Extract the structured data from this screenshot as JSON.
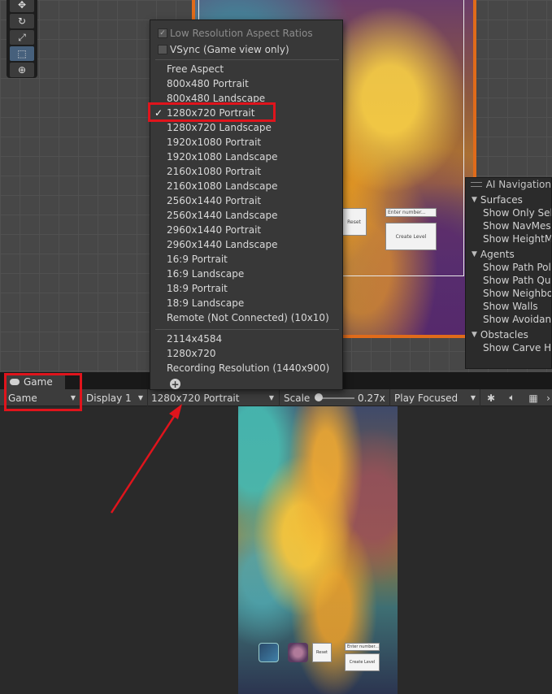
{
  "scene": {
    "tools": [
      "view-tool",
      "rotate-tool",
      "scale-tool",
      "rect-tool",
      "transform-tool"
    ],
    "frame_labels": {
      "reset": "Reset",
      "input_placeholder": "Enter number...",
      "create_level": "Create Level"
    }
  },
  "ai_navigation": {
    "title": "AI Navigation",
    "sections": [
      {
        "name": "Surfaces",
        "items": [
          "Show Only Sele",
          "Show NavMesh",
          "Show HeightM"
        ]
      },
      {
        "name": "Agents",
        "items": [
          "Show Path Poly",
          "Show Path Que",
          "Show Neighbo",
          "Show Walls",
          "Show Avoidanc"
        ]
      },
      {
        "name": "Obstacles",
        "items": [
          "Show Carve Hu"
        ]
      }
    ]
  },
  "resolution_menu": {
    "toggles": [
      {
        "label": "Low Resolution Aspect Ratios",
        "checked": true,
        "enabled": false
      },
      {
        "label": "VSync (Game view only)",
        "checked": false,
        "enabled": true
      }
    ],
    "items": [
      "Free Aspect",
      "800x480 Portrait",
      "800x480 Landscape",
      "1280x720 Portrait",
      "1280x720 Landscape",
      "1920x1080 Portrait",
      "1920x1080 Landscape",
      "2160x1080 Portrait",
      "2160x1080 Landscape",
      "2560x1440 Portrait",
      "2560x1440 Landscape",
      "2960x1440 Portrait",
      "2960x1440 Landscape",
      "16:9 Portrait",
      "16:9 Landscape",
      "18:9 Portrait",
      "18:9 Landscape",
      "Remote (Not Connected) (10x10)"
    ],
    "selected": "1280x720 Portrait",
    "custom_items": [
      "2114x4584",
      "1280x720",
      "Recording Resolution (1440x900)"
    ],
    "add_icon": "plus-icon"
  },
  "game_tab": {
    "tab_label": "Game",
    "tab_icon": "gamepad-icon"
  },
  "toolbar": {
    "view_type": "Game",
    "display": "Display 1",
    "resolution": "1280x720 Portrait",
    "scale_label": "Scale",
    "scale_value": "0.27x",
    "play_mode": "Play Focused",
    "icons": [
      "bug-icon",
      "audio-icon",
      "keyboard-icon"
    ]
  },
  "game_view": {
    "reset": "Reset",
    "input_placeholder": "Enter number...",
    "create_level": "Create Level"
  },
  "colors": {
    "highlight": "#e0141c",
    "scene_border": "#e06b1a",
    "menu_bg": "#383838",
    "toolbar_bg": "#3c3c3c"
  }
}
